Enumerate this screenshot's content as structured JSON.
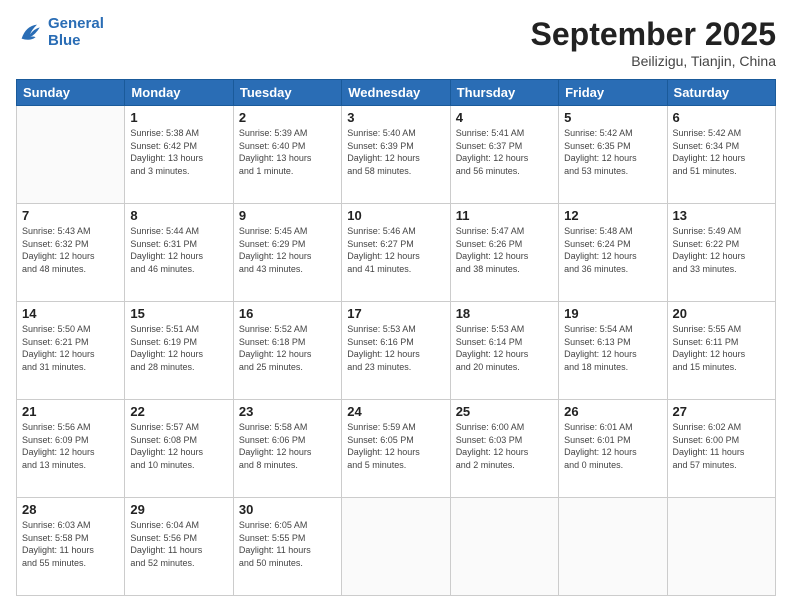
{
  "logo": {
    "line1": "General",
    "line2": "Blue"
  },
  "header": {
    "month": "September 2025",
    "location": "Beilizigu, Tianjin, China"
  },
  "weekdays": [
    "Sunday",
    "Monday",
    "Tuesday",
    "Wednesday",
    "Thursday",
    "Friday",
    "Saturday"
  ],
  "weeks": [
    [
      {
        "day": "",
        "info": ""
      },
      {
        "day": "1",
        "info": "Sunrise: 5:38 AM\nSunset: 6:42 PM\nDaylight: 13 hours\nand 3 minutes."
      },
      {
        "day": "2",
        "info": "Sunrise: 5:39 AM\nSunset: 6:40 PM\nDaylight: 13 hours\nand 1 minute."
      },
      {
        "day": "3",
        "info": "Sunrise: 5:40 AM\nSunset: 6:39 PM\nDaylight: 12 hours\nand 58 minutes."
      },
      {
        "day": "4",
        "info": "Sunrise: 5:41 AM\nSunset: 6:37 PM\nDaylight: 12 hours\nand 56 minutes."
      },
      {
        "day": "5",
        "info": "Sunrise: 5:42 AM\nSunset: 6:35 PM\nDaylight: 12 hours\nand 53 minutes."
      },
      {
        "day": "6",
        "info": "Sunrise: 5:42 AM\nSunset: 6:34 PM\nDaylight: 12 hours\nand 51 minutes."
      }
    ],
    [
      {
        "day": "7",
        "info": "Sunrise: 5:43 AM\nSunset: 6:32 PM\nDaylight: 12 hours\nand 48 minutes."
      },
      {
        "day": "8",
        "info": "Sunrise: 5:44 AM\nSunset: 6:31 PM\nDaylight: 12 hours\nand 46 minutes."
      },
      {
        "day": "9",
        "info": "Sunrise: 5:45 AM\nSunset: 6:29 PM\nDaylight: 12 hours\nand 43 minutes."
      },
      {
        "day": "10",
        "info": "Sunrise: 5:46 AM\nSunset: 6:27 PM\nDaylight: 12 hours\nand 41 minutes."
      },
      {
        "day": "11",
        "info": "Sunrise: 5:47 AM\nSunset: 6:26 PM\nDaylight: 12 hours\nand 38 minutes."
      },
      {
        "day": "12",
        "info": "Sunrise: 5:48 AM\nSunset: 6:24 PM\nDaylight: 12 hours\nand 36 minutes."
      },
      {
        "day": "13",
        "info": "Sunrise: 5:49 AM\nSunset: 6:22 PM\nDaylight: 12 hours\nand 33 minutes."
      }
    ],
    [
      {
        "day": "14",
        "info": "Sunrise: 5:50 AM\nSunset: 6:21 PM\nDaylight: 12 hours\nand 31 minutes."
      },
      {
        "day": "15",
        "info": "Sunrise: 5:51 AM\nSunset: 6:19 PM\nDaylight: 12 hours\nand 28 minutes."
      },
      {
        "day": "16",
        "info": "Sunrise: 5:52 AM\nSunset: 6:18 PM\nDaylight: 12 hours\nand 25 minutes."
      },
      {
        "day": "17",
        "info": "Sunrise: 5:53 AM\nSunset: 6:16 PM\nDaylight: 12 hours\nand 23 minutes."
      },
      {
        "day": "18",
        "info": "Sunrise: 5:53 AM\nSunset: 6:14 PM\nDaylight: 12 hours\nand 20 minutes."
      },
      {
        "day": "19",
        "info": "Sunrise: 5:54 AM\nSunset: 6:13 PM\nDaylight: 12 hours\nand 18 minutes."
      },
      {
        "day": "20",
        "info": "Sunrise: 5:55 AM\nSunset: 6:11 PM\nDaylight: 12 hours\nand 15 minutes."
      }
    ],
    [
      {
        "day": "21",
        "info": "Sunrise: 5:56 AM\nSunset: 6:09 PM\nDaylight: 12 hours\nand 13 minutes."
      },
      {
        "day": "22",
        "info": "Sunrise: 5:57 AM\nSunset: 6:08 PM\nDaylight: 12 hours\nand 10 minutes."
      },
      {
        "day": "23",
        "info": "Sunrise: 5:58 AM\nSunset: 6:06 PM\nDaylight: 12 hours\nand 8 minutes."
      },
      {
        "day": "24",
        "info": "Sunrise: 5:59 AM\nSunset: 6:05 PM\nDaylight: 12 hours\nand 5 minutes."
      },
      {
        "day": "25",
        "info": "Sunrise: 6:00 AM\nSunset: 6:03 PM\nDaylight: 12 hours\nand 2 minutes."
      },
      {
        "day": "26",
        "info": "Sunrise: 6:01 AM\nSunset: 6:01 PM\nDaylight: 12 hours\nand 0 minutes."
      },
      {
        "day": "27",
        "info": "Sunrise: 6:02 AM\nSunset: 6:00 PM\nDaylight: 11 hours\nand 57 minutes."
      }
    ],
    [
      {
        "day": "28",
        "info": "Sunrise: 6:03 AM\nSunset: 5:58 PM\nDaylight: 11 hours\nand 55 minutes."
      },
      {
        "day": "29",
        "info": "Sunrise: 6:04 AM\nSunset: 5:56 PM\nDaylight: 11 hours\nand 52 minutes."
      },
      {
        "day": "30",
        "info": "Sunrise: 6:05 AM\nSunset: 5:55 PM\nDaylight: 11 hours\nand 50 minutes."
      },
      {
        "day": "",
        "info": ""
      },
      {
        "day": "",
        "info": ""
      },
      {
        "day": "",
        "info": ""
      },
      {
        "day": "",
        "info": ""
      }
    ]
  ]
}
